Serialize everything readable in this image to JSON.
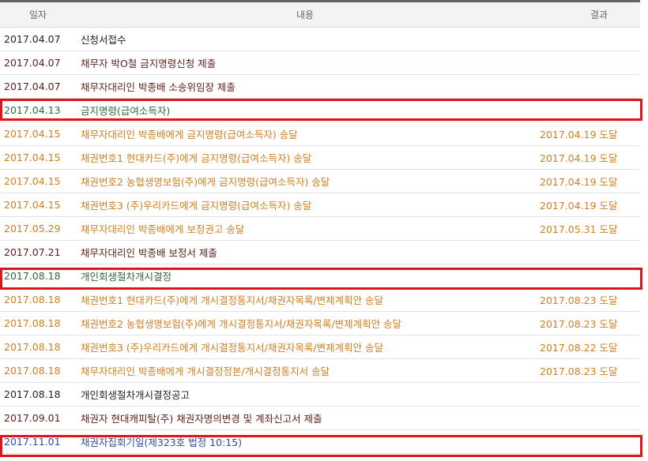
{
  "header": {
    "date": "일자",
    "content": "내용",
    "result": "결과"
  },
  "colors": {
    "black": "#222222",
    "maroon": "#5a1f1a",
    "orange": "#cf7f22",
    "green": "#2f6b3a",
    "blue": "#2d4f96",
    "highlight": "#e0141c"
  },
  "rows": [
    {
      "date": "2017.04.07",
      "content": "신청서접수",
      "result": ""
    },
    {
      "date": "2017.04.07",
      "content": "채무자 박O철 금지명령신청 제출",
      "result": ""
    },
    {
      "date": "2017.04.07",
      "content": "채무자대리인 박종배 소송위임장 제출",
      "result": ""
    },
    {
      "date": "2017.04.13",
      "content": "금지명령(급여소득자)",
      "result": ""
    },
    {
      "date": "2017.04.15",
      "content": "채무자대리인 박종배에게 금지명령(급여소득자) 송달",
      "result": "2017.04.19 도달"
    },
    {
      "date": "2017.04.15",
      "content": "채권번호1 현대카드(주)에게 금지명령(급여소득자) 송달",
      "result": "2017.04.19 도달"
    },
    {
      "date": "2017.04.15",
      "content": "채권번호2 농협생명보험(주)에게 금지명령(급여소득자) 송달",
      "result": "2017.04.19 도달"
    },
    {
      "date": "2017.04.15",
      "content": "채권번호3 (주)우리카드에게 금지명령(급여소득자) 송달",
      "result": "2017.04.19 도달"
    },
    {
      "date": "2017.05.29",
      "content": "채무자대리인 박종배에게 보정권고 송달",
      "result": "2017.05.31 도달"
    },
    {
      "date": "2017.07.21",
      "content": "채무자대리인 박종배 보정서 제출",
      "result": ""
    },
    {
      "date": "2017.08.18",
      "content": "개인회생절차개시결정",
      "result": ""
    },
    {
      "date": "2017.08.18",
      "content": "채권번호1 현대카드(주)에게 개시결정통지서/채권자목록/변제계획안 송달",
      "result": "2017.08.23 도달"
    },
    {
      "date": "2017.08.18",
      "content": "채권번호2 농협생명보험(주)에게 개시결정통지서/채권자목록/변제계획안 송달",
      "result": "2017.08.23 도달"
    },
    {
      "date": "2017.08.18",
      "content": "채권번호3 (주)우리카드에게 개시결정통지서/채권자목록/변제계획안 송달",
      "result": "2017.08.22 도달"
    },
    {
      "date": "2017.08.18",
      "content": "채무자대리인 박종배에게 개시결정정본/개시결정통지서 송달",
      "result": "2017.08.23 도달"
    },
    {
      "date": "2017.08.18",
      "content": "개인회생절차개시결정공고",
      "result": ""
    },
    {
      "date": "2017.09.01",
      "content": "채권자 현대캐피탈(주) 채권자명의변경 및 계좌신고서 제출",
      "result": ""
    },
    {
      "date": "2017.11.01",
      "content": "채권자집회기일(제323호 법정 10:15)",
      "result": ""
    }
  ]
}
